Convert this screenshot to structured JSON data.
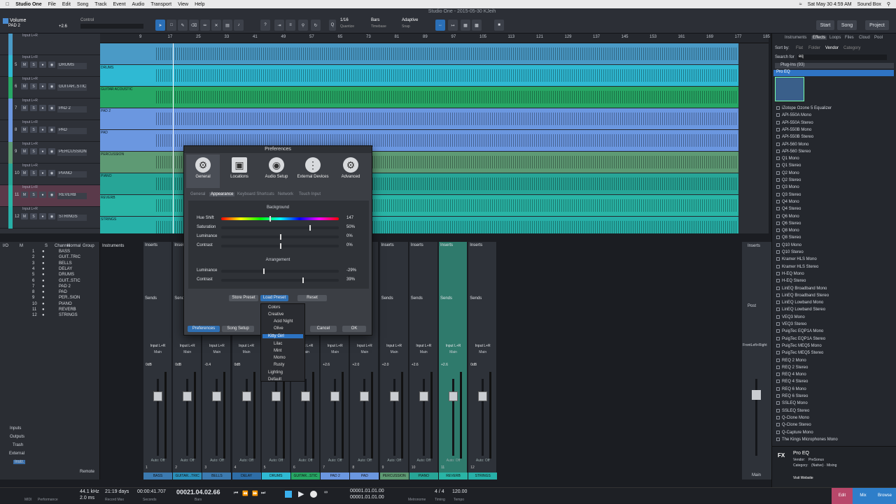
{
  "menubar": {
    "app": "Studio One",
    "items": [
      "File",
      "Edit",
      "Song",
      "Track",
      "Event",
      "Audio",
      "Transport",
      "View",
      "Help"
    ],
    "clock": "Sat May 30  4:59 AM",
    "user": "Sound Box"
  },
  "toolbar": {
    "doc_title": "Studio One - 2015-05-30 KJeih",
    "track_name": "PAD 2",
    "param": "Volume",
    "control": "Control",
    "value": "+2.6",
    "quantize": "1/16",
    "quantize_lbl": "Quantize",
    "timebase": "Bars",
    "timebase_lbl": "Timebase",
    "snap": "Adaptive",
    "snap_lbl": "Snap",
    "nav": [
      "Start",
      "Song",
      "Project"
    ]
  },
  "ruler": [
    "9",
    "17",
    "25",
    "33",
    "41",
    "49",
    "57",
    "65",
    "73",
    "81",
    "89",
    "97",
    "105",
    "113",
    "121",
    "129",
    "137",
    "145",
    "153",
    "161",
    "169",
    "177",
    "185"
  ],
  "tracks": [
    {
      "num": "",
      "name": "",
      "input": "Input L+R",
      "color": "#4a9ac6"
    },
    {
      "num": "5",
      "name": "DRUMS",
      "input": "Input L+R",
      "color": "#2fb9d3"
    },
    {
      "num": "6",
      "name": "GUITAR..STIC",
      "input": "Input L+R",
      "color": "#27a765"
    },
    {
      "num": "7",
      "name": "PAD 2",
      "input": "Input L+R",
      "color": "#6b97e0"
    },
    {
      "num": "8",
      "name": "PAD",
      "input": "Input L+R",
      "color": "#6b97e0"
    },
    {
      "num": "9",
      "name": "PERCUSSION",
      "input": "Input L+R",
      "color": "#5e9a74"
    },
    {
      "num": "10",
      "name": "PIANO",
      "input": "Input L+R",
      "color": "#27a597"
    },
    {
      "num": "11",
      "name": "REVERB",
      "input": "Input L+R",
      "color": "#29b5a6"
    },
    {
      "num": "12",
      "name": "STRINGS",
      "input": "Input L+R",
      "color": "#27b0a8"
    }
  ],
  "lanes": [
    "",
    "DRUMS",
    "GUITAR ACOUSTIC",
    "PAD 2",
    "PAD",
    "PERCUSSION",
    "PIANO",
    "REVERB",
    "STRINGS"
  ],
  "browser": {
    "tabs": [
      "Instruments",
      "Effects",
      "Loops",
      "Files",
      "Cloud",
      "Pool"
    ],
    "sortby": "Sort by:",
    "sorts": [
      "Flat",
      "Folder",
      "Vendor",
      "Category"
    ],
    "search_lbl": "Search for",
    "search": "eq",
    "header": "Plug-Ins (93)",
    "selected": "Pro EQ",
    "plugins": [
      "iZotope Ozone 5 Equalizer",
      "API-550A Mono",
      "API-550A Stereo",
      "API-550B Mono",
      "API-550B Stereo",
      "API-560 Mono",
      "API-560 Stereo",
      "Q1 Mono",
      "Q1 Stereo",
      "Q2 Mono",
      "Q2 Stereo",
      "Q3 Mono",
      "Q3 Stereo",
      "Q4 Mono",
      "Q4 Stereo",
      "Q6 Mono",
      "Q6 Stereo",
      "Q8 Mono",
      "Q8 Stereo",
      "Q10 Mono",
      "Q10 Stereo",
      "Kramer HLS Mono",
      "Kramer HLS Stereo",
      "H-EQ Mono",
      "H-EQ Stereo",
      "LinEQ Broadband Mono",
      "LinEQ Broadband Stereo",
      "LinEQ Lowband Mono",
      "LinEQ Lowband Stereo",
      "VEQ3 Mono",
      "VEQ3 Stereo",
      "PuigTec EQP1A Mono",
      "PuigTec EQP1A Stereo",
      "PuigTec MEQ5 Mono",
      "PuigTec MEQ5 Stereo",
      "REQ 2 Mono",
      "REQ 2 Stereo",
      "REQ 4 Mono",
      "REQ 4 Stereo",
      "REQ 6 Mono",
      "REQ 6 Stereo",
      "SSLEQ Mono",
      "SSLEQ Stereo",
      "Q-Clone Mono",
      "Q-Clone Stereo",
      "Q-Capture Mono",
      "The Kings Microphones Mono"
    ],
    "info": {
      "name": "Pro EQ",
      "vendor_lbl": "Vendor:",
      "vendor": "PreSonus",
      "category_lbl": "Category:",
      "category": "(Native) · Mixing",
      "website": "Visit Website"
    }
  },
  "console": {
    "head": [
      "M",
      "S",
      "Normal"
    ],
    "cols": [
      "Channel",
      "Group"
    ],
    "instruments": "Instruments",
    "channels": [
      "BASS",
      "GUIT..TRIC",
      "BELLS",
      "DELAY",
      "DRUMS",
      "GUIT..STIC",
      "PAD 2",
      "PAD",
      "PER..SION",
      "PIANO",
      "REVERB",
      "STRINGS"
    ],
    "side": [
      "I/O",
      "Inputs",
      "Outputs",
      "Trash",
      "External",
      "Instr.",
      "Remote"
    ],
    "strips": [
      {
        "name": "BASS",
        "num": "1",
        "db": "0dB",
        "color": "#3c7ab0"
      },
      {
        "name": "GUITAR...TRIC",
        "num": "2",
        "db": "0dB",
        "color": "#2b8fba"
      },
      {
        "name": "BELLS",
        "num": "3",
        "db": "-0.4",
        "color": "#3c7ab0"
      },
      {
        "name": "DELAY",
        "num": "4",
        "db": "0dB",
        "color": "#2e6da6"
      },
      {
        "name": "DRUMS",
        "num": "5",
        "db": "0dB",
        "color": "#2fb9d3"
      },
      {
        "name": "GUITAR...STIC",
        "num": "6",
        "db": "0dB",
        "color": "#27a765"
      },
      {
        "name": "PAD 2",
        "num": "7",
        "db": "+2.6",
        "color": "#6b97e0"
      },
      {
        "name": "PAD",
        "num": "8",
        "db": "+2.0",
        "color": "#6b97e0"
      },
      {
        "name": "PERCUSSION",
        "num": "9",
        "db": "+2.0",
        "color": "#5e9a74"
      },
      {
        "name": "PIANO",
        "num": "10",
        "db": "+2.6",
        "color": "#27a597"
      },
      {
        "name": "REVERB",
        "num": "11",
        "db": "+2.6",
        "color": "#29b5a6"
      },
      {
        "name": "STRINGS",
        "num": "12",
        "db": "0dB",
        "color": "#27b0a8"
      }
    ],
    "inserts": "Inserts",
    "sends": "Sends",
    "input": "Input L+R",
    "main": "Main",
    "auto": "Auto: Off",
    "post": "Post",
    "fl": "FrontLeft+Right",
    "mainout": "Main"
  },
  "transport": {
    "rate": "44.1 kHz",
    "latency": "2.0 ms",
    "days": "21:19 days",
    "rec_lbl": "Record Max",
    "time": "00:00:41.707",
    "time_lbl": "Seconds",
    "bars": "00021.04.02.66",
    "bars_lbl": "Bars",
    "l": "00001.01.01.00",
    "r": "00001.01.01.00",
    "sig": "4 / 4",
    "sig_lbl": "Timing",
    "tempo": "120.00",
    "tempo_lbl": "Tempo",
    "metro": "Metronome",
    "midi": "MIDI",
    "perf": "Performance",
    "btns": [
      "Edit",
      "Mix",
      "Browse"
    ]
  },
  "prefs": {
    "title": "Preferences",
    "icons": [
      "General",
      "Locations",
      "Audio Setup",
      "External Devices",
      "Advanced"
    ],
    "tabs": [
      "General",
      "Appearance",
      "Keyboard Shortcuts",
      "Network",
      "Touch Input"
    ],
    "bg_title": "Background",
    "arr_title": "Arrangement",
    "bg": [
      {
        "label": "Hue Shift",
        "value": "147",
        "pos": 0.41
      },
      {
        "label": "Saturation",
        "value": "50%",
        "pos": 0.75
      },
      {
        "label": "Luminance",
        "value": "0%",
        "pos": 0.5
      },
      {
        "label": "Contrast",
        "value": "0%",
        "pos": 0.5
      }
    ],
    "arr": [
      {
        "label": "Luminance",
        "value": "-29%",
        "pos": 0.36
      },
      {
        "label": "Contrast",
        "value": "39%",
        "pos": 0.69
      }
    ],
    "store": "Store Preset",
    "load": "Load Preset",
    "reset": "Reset",
    "btn_prefs": "Preferences",
    "btn_song": "Song Setup",
    "cancel": "Cancel",
    "ok": "OK",
    "menu": [
      "Colors",
      "Creative",
      "Acid Night",
      "Olive",
      "Kitty Girl",
      "Lilac",
      "Mint",
      "Momo",
      "Rusty",
      "Lighting",
      "Default"
    ]
  }
}
